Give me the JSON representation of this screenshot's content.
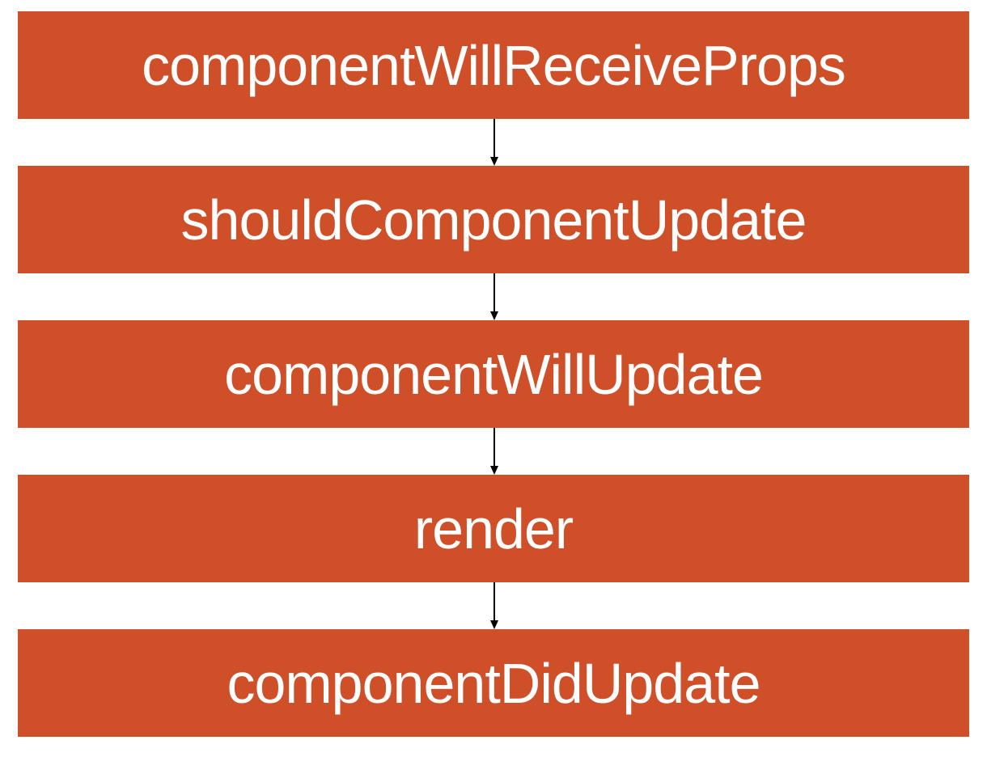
{
  "diagram": {
    "colors": {
      "box_fill": "#cf4f29",
      "box_text": "#ffffff",
      "arrow": "#000000",
      "background": "#ffffff"
    },
    "stages": [
      {
        "label": "componentWillReceiveProps"
      },
      {
        "label": "shouldComponentUpdate"
      },
      {
        "label": "componentWillUpdate"
      },
      {
        "label": "render"
      },
      {
        "label": "componentDidUpdate"
      }
    ]
  }
}
